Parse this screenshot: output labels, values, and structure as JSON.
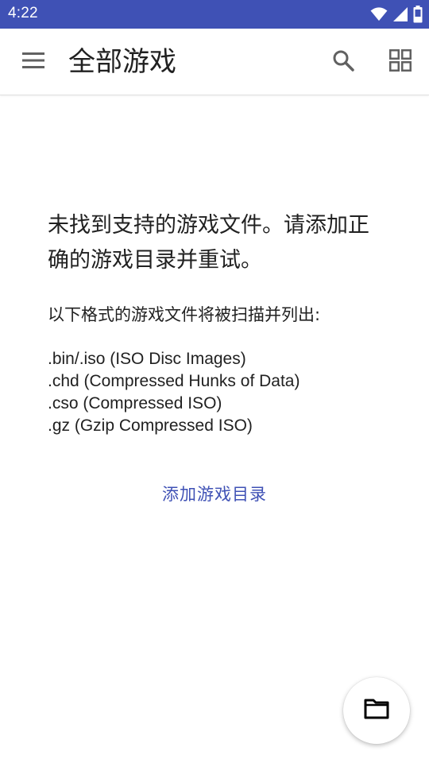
{
  "status_bar": {
    "time": "4:22",
    "icons": [
      "wifi-icon",
      "signal-icon",
      "battery-icon"
    ]
  },
  "app_bar": {
    "title": "全部游戏",
    "menu_icon": "menu-icon",
    "search_icon": "search-icon",
    "view_icon": "grid-view-icon"
  },
  "empty_state": {
    "title": "未找到支持的游戏文件。请添加正确的游戏目录并重试。",
    "formats_intro": "以下格式的游戏文件将被扫描并列出:",
    "formats": [
      ".bin/.iso (ISO Disc Images)",
      ".chd (Compressed Hunks of Data)",
      ".cso (Compressed ISO)",
      ".gz (Gzip Compressed ISO)"
    ],
    "add_directory_label": "添加游戏目录"
  },
  "fab": {
    "icon": "folder-icon"
  },
  "colors": {
    "primary": "#3f51b5",
    "text": "#212121",
    "icon": "#616161"
  }
}
